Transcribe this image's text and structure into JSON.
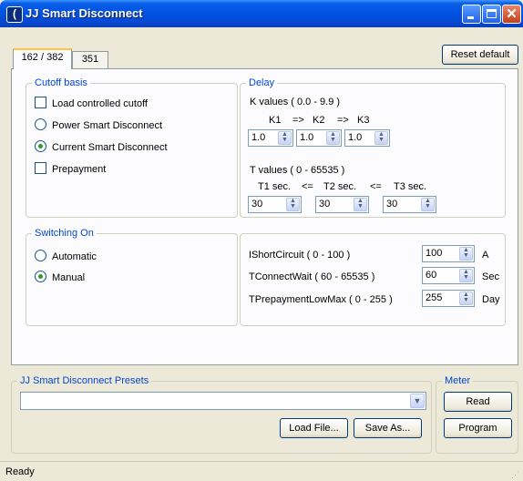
{
  "window": {
    "title": "JJ Smart Disconnect",
    "app_icon_glyph": "(́",
    "app_icon": "jj-app-icon"
  },
  "toolbar": {
    "reset_label": "Reset default"
  },
  "tabs": [
    {
      "label": "162 / 382",
      "active": true
    },
    {
      "label": "351",
      "active": false
    }
  ],
  "cutoff": {
    "legend": "Cutoff basis",
    "options": [
      {
        "label": "Load controlled cutoff",
        "kind": "checkbox",
        "checked": false
      },
      {
        "label": "Power Smart Disconnect",
        "kind": "radio",
        "checked": false
      },
      {
        "label": "Current Smart Disconnect",
        "kind": "radio",
        "checked": true
      },
      {
        "label": "Prepayment",
        "kind": "checkbox",
        "checked": false
      }
    ]
  },
  "delay": {
    "legend": "Delay",
    "k_range": "K values ( 0.0 - 9.9 )",
    "k_header": [
      "K1",
      "=>",
      "K2",
      "=>",
      "K3"
    ],
    "k_values": [
      "1.0",
      "1.0",
      "1.0"
    ],
    "t_range": "T values ( 0 - 65535 )",
    "t_header": [
      "T1 sec.",
      "<=",
      "T2 sec.",
      "<=",
      "T3 sec."
    ],
    "t_values": [
      "30",
      "30",
      "30"
    ]
  },
  "switching": {
    "legend": "Switching On",
    "options": [
      {
        "label": "Automatic",
        "checked": false
      },
      {
        "label": "Manual",
        "checked": true
      }
    ]
  },
  "params": [
    {
      "label": "IShortCircuit ( 0 - 100 )",
      "value": "100",
      "unit": "A"
    },
    {
      "label": "TConnectWait ( 60 - 65535 )",
      "value": "60",
      "unit": "Sec"
    },
    {
      "label": "TPrepaymentLowMax ( 0 - 255 )",
      "value": "255",
      "unit": "Day"
    }
  ],
  "presets": {
    "legend": "JJ Smart Disconnect Presets",
    "selected": "",
    "load_label": "Load File...",
    "save_label": "Save As..."
  },
  "meter": {
    "legend": "Meter",
    "read_label": "Read",
    "program_label": "Program"
  },
  "status": {
    "text": "Ready"
  },
  "colors": {
    "title_bar": "#0052e0",
    "legend_text": "#0046d5",
    "tab_highlight": "#ffc83c",
    "radio_dot": "#21a121"
  }
}
